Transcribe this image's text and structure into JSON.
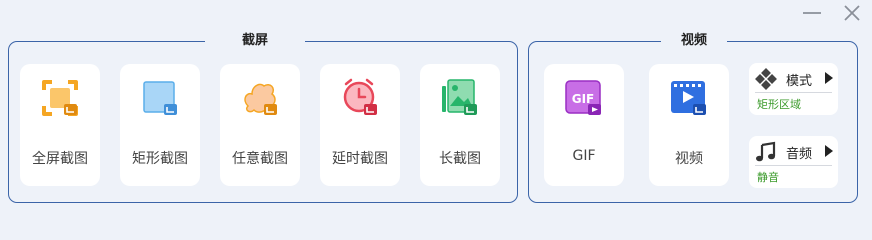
{
  "window": {
    "minimize_icon": "minimize-icon",
    "close_icon": "close-icon"
  },
  "screenshot_group": {
    "title": "截屏",
    "items": [
      {
        "label": "全屏截图",
        "icon": "fullscreen-capture-icon",
        "color": "#f5a623"
      },
      {
        "label": "矩形截图",
        "icon": "rectangle-capture-icon",
        "color": "#5aaeea"
      },
      {
        "label": "任意截图",
        "icon": "freeform-capture-icon",
        "color": "#f5a623"
      },
      {
        "label": "延时截图",
        "icon": "timer-capture-icon",
        "color": "#e8485a"
      },
      {
        "label": "长截图",
        "icon": "scroll-capture-icon",
        "color": "#27b56b"
      }
    ]
  },
  "record_group": {
    "title": "视频",
    "items": [
      {
        "label": "GIF",
        "icon": "gif-record-icon",
        "icon_text": "GIF",
        "color": "#b13ed8"
      },
      {
        "label": "视频",
        "icon": "video-record-icon",
        "color": "#2f6fe0"
      }
    ],
    "options": {
      "mode": {
        "name": "模式",
        "value": "矩形区域",
        "icon": "mode-diamonds-icon"
      },
      "audio": {
        "name": "音频",
        "value": "静音",
        "icon": "music-note-icon"
      }
    }
  },
  "colors": {
    "background": "#eef2f9",
    "group_border": "#3b64a8",
    "option_value": "#3a9a2a"
  }
}
